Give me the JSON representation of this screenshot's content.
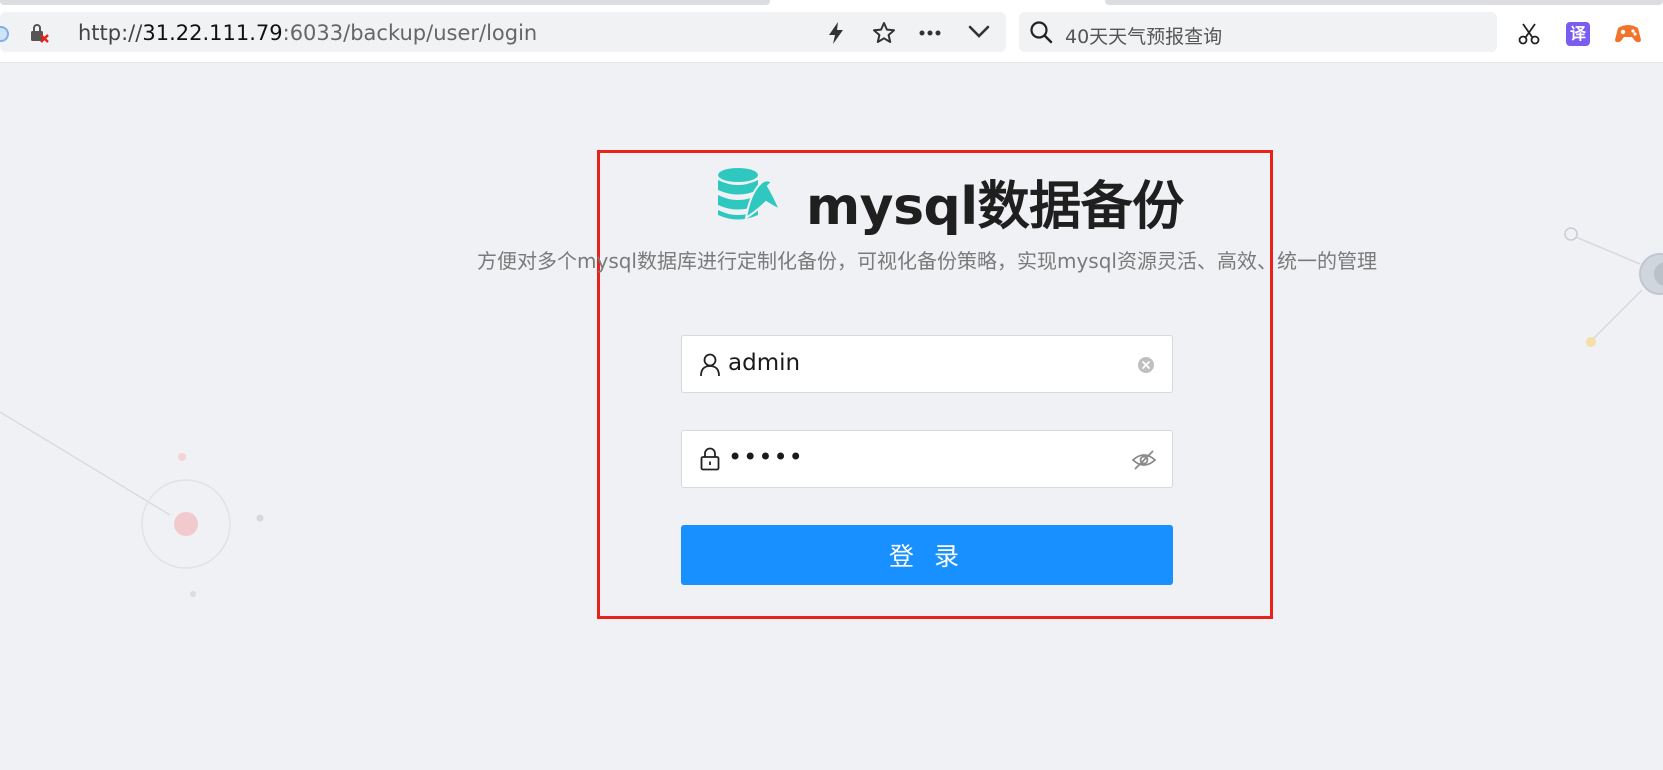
{
  "browser": {
    "url_scheme": "http://",
    "url_host": "31.22.111.79",
    "url_rest": ":6033/backup/user/login",
    "search_text": "40天天气预报查询",
    "icons": [
      "site-info-icon",
      "insecure-lock-icon",
      "lightning-icon",
      "star-icon",
      "more-icon",
      "chevron-down-icon",
      "search-icon",
      "scissors-icon",
      "translate-icon",
      "game-icon"
    ],
    "translate_glyph": "译"
  },
  "login": {
    "title": "mysql数据备份",
    "subtitle": "方便对多个mysql数据库进行定制化备份，可视化备份策略，实现mysql资源灵活、高效、统一的管理",
    "username_value": "admin",
    "password_masked": "•••••",
    "login_button": "登 录",
    "logo_icon": "mysql-dolphin-database-icon"
  },
  "colors": {
    "primary_button": "#1890ff",
    "highlight_border": "#e8221b",
    "logo_teal": "#2fc8c0",
    "background": "#f0f1f4"
  }
}
